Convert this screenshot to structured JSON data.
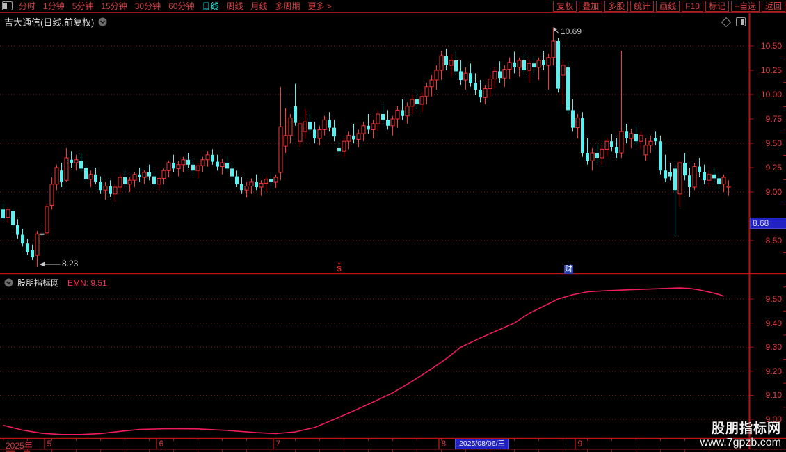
{
  "window": {
    "title": "吉大通信(日线.前复权)"
  },
  "toolbar": {
    "left_items": [
      {
        "label": "分时"
      },
      {
        "label": "1分钟"
      },
      {
        "label": "5分钟"
      },
      {
        "label": "15分钟"
      },
      {
        "label": "30分钟"
      },
      {
        "label": "60分钟"
      },
      {
        "label": "日线",
        "active": true
      },
      {
        "label": "周线"
      },
      {
        "label": "月线"
      },
      {
        "label": "多周期"
      },
      {
        "label": "更多 >"
      }
    ],
    "right_buttons": [
      "复权",
      "叠加",
      "多股",
      "统计",
      "画线",
      "F10",
      "标记",
      "+自选",
      "返回"
    ]
  },
  "indicator": {
    "source": "股朋指标网",
    "label": "EMN:",
    "value": "9.51"
  },
  "annotations": {
    "high": "10.69",
    "low": "8.23"
  },
  "price_tag": "8.68",
  "markers": {
    "dollar_arrow": "▲",
    "dollar": "$",
    "cai": "财"
  },
  "timeline": {
    "year": "2025年",
    "selected_date": "2025/08/06/三",
    "selected_index": 93,
    "months": [
      {
        "label": "5",
        "index": 9
      },
      {
        "label": "6",
        "index": 32
      },
      {
        "label": "7",
        "index": 56
      },
      {
        "label": "8",
        "index": 90
      },
      {
        "label": "9",
        "index": 118
      }
    ]
  },
  "watermark": {
    "line1": "股朋指标网",
    "line2": "www.7gpzb.com"
  },
  "icons": [
    "window-layout-icon",
    "chevron-down-circle-icon",
    "diamond-icon",
    "right-panel-toggle-icon",
    "up-arrow-icon"
  ],
  "colors": {
    "background": "#000000",
    "up_candle": "#ff3434",
    "down_candle": "#5af0f0",
    "neutral_candle": "#e0e0e0",
    "grid": "#8a1e1e",
    "frame": "#b41515",
    "axis_text": "#e04040",
    "toolbar_text": "#d23c3c",
    "active_period": "#2ee0e0",
    "title_text": "#dcdcdc",
    "indicator_line": "#ee1c5c",
    "emn_text": "#ee3350",
    "tag_blue": "#2121c4",
    "marker_blue": "#2440b8",
    "marker_red": "#e22828",
    "annotation_text": "#c8c8c8",
    "watermark": "#f2f2f2"
  },
  "chart_data": {
    "type": "candlestick",
    "title": "吉大通信(日线.前复权)",
    "main_panel": {
      "type": "candlestick",
      "ylim": [
        8.2,
        10.75
      ],
      "y_ticks": [
        {
          "label": "10.50",
          "value": 10.5
        },
        {
          "label": "10.25",
          "value": 10.25
        },
        {
          "label": "10.00",
          "value": 10.0
        },
        {
          "label": "9.75",
          "value": 9.75
        },
        {
          "label": "9.50",
          "value": 9.5
        },
        {
          "label": "9.25",
          "value": 9.25
        },
        {
          "label": "9.00",
          "value": 9.0
        },
        {
          "label": "8.50",
          "value": 8.5
        }
      ],
      "grid_levels": [
        10.5,
        10.0,
        9.5,
        9.0,
        8.5
      ],
      "high_point": {
        "index": 113,
        "price": 10.69
      },
      "low_point": {
        "index": 7,
        "price": 8.23
      },
      "last_price": 8.68,
      "white_candles": [
        8
      ],
      "candles": [
        [
          8.82,
          8.88,
          8.7,
          8.73
        ],
        [
          8.74,
          8.85,
          8.68,
          8.82
        ],
        [
          8.8,
          8.83,
          8.62,
          8.66
        ],
        [
          8.66,
          8.72,
          8.52,
          8.56
        ],
        [
          8.56,
          8.62,
          8.44,
          8.47
        ],
        [
          8.47,
          8.52,
          8.35,
          8.38
        ],
        [
          8.4,
          8.46,
          8.3,
          8.33
        ],
        [
          8.35,
          8.6,
          8.23,
          8.57
        ],
        [
          8.57,
          8.66,
          8.48,
          8.57
        ],
        [
          8.58,
          8.88,
          8.55,
          8.85
        ],
        [
          8.86,
          9.15,
          8.82,
          9.08
        ],
        [
          9.08,
          9.28,
          9.02,
          9.25
        ],
        [
          9.22,
          9.3,
          9.05,
          9.1
        ],
        [
          9.12,
          9.45,
          9.1,
          9.35
        ],
        [
          9.33,
          9.42,
          9.25,
          9.3
        ],
        [
          9.3,
          9.38,
          9.22,
          9.33
        ],
        [
          9.32,
          9.4,
          9.2,
          9.24
        ],
        [
          9.25,
          9.3,
          9.1,
          9.13
        ],
        [
          9.13,
          9.22,
          9.05,
          9.18
        ],
        [
          9.18,
          9.25,
          9.08,
          9.1
        ],
        [
          9.1,
          9.16,
          8.98,
          9.02
        ],
        [
          9.02,
          9.1,
          8.92,
          9.06
        ],
        [
          9.06,
          9.12,
          8.95,
          8.98
        ],
        [
          8.98,
          9.08,
          8.9,
          9.05
        ],
        [
          9.05,
          9.18,
          9.0,
          9.15
        ],
        [
          9.15,
          9.22,
          9.05,
          9.08
        ],
        [
          9.08,
          9.15,
          9.0,
          9.12
        ],
        [
          9.12,
          9.2,
          9.05,
          9.18
        ],
        [
          9.18,
          9.25,
          9.1,
          9.15
        ],
        [
          9.15,
          9.22,
          9.08,
          9.2
        ],
        [
          9.2,
          9.28,
          9.12,
          9.16
        ],
        [
          9.16,
          9.22,
          9.05,
          9.08
        ],
        [
          9.08,
          9.16,
          9.02,
          9.14
        ],
        [
          9.14,
          9.24,
          9.08,
          9.22
        ],
        [
          9.22,
          9.32,
          9.15,
          9.3
        ],
        [
          9.3,
          9.38,
          9.2,
          9.24
        ],
        [
          9.24,
          9.32,
          9.16,
          9.28
        ],
        [
          9.28,
          9.36,
          9.2,
          9.33
        ],
        [
          9.33,
          9.4,
          9.25,
          9.28
        ],
        [
          9.28,
          9.35,
          9.18,
          9.22
        ],
        [
          9.22,
          9.3,
          9.14,
          9.27
        ],
        [
          9.27,
          9.36,
          9.2,
          9.33
        ],
        [
          9.33,
          9.42,
          9.26,
          9.38
        ],
        [
          9.38,
          9.44,
          9.28,
          9.31
        ],
        [
          9.31,
          9.38,
          9.22,
          9.26
        ],
        [
          9.26,
          9.34,
          9.18,
          9.3
        ],
        [
          9.3,
          9.36,
          9.2,
          9.24
        ],
        [
          9.24,
          9.3,
          9.12,
          9.16
        ],
        [
          9.16,
          9.22,
          9.05,
          9.08
        ],
        [
          9.08,
          9.15,
          8.98,
          9.02
        ],
        [
          9.02,
          9.1,
          8.94,
          9.06
        ],
        [
          9.06,
          9.14,
          8.98,
          9.1
        ],
        [
          9.1,
          9.18,
          9.02,
          9.05
        ],
        [
          9.05,
          9.12,
          8.96,
          9.09
        ],
        [
          9.09,
          9.16,
          9.0,
          9.13
        ],
        [
          9.13,
          9.2,
          9.06,
          9.1
        ],
        [
          9.1,
          9.18,
          9.04,
          9.15
        ],
        [
          9.2,
          10.08,
          9.12,
          9.67
        ],
        [
          9.47,
          9.86,
          9.4,
          9.58
        ],
        [
          9.58,
          9.8,
          9.5,
          9.76
        ],
        [
          9.88,
          10.11,
          9.68,
          9.71
        ],
        [
          9.52,
          9.74,
          9.46,
          9.7
        ],
        [
          9.62,
          9.85,
          9.55,
          9.72
        ],
        [
          9.72,
          9.8,
          9.6,
          9.64
        ],
        [
          9.64,
          9.72,
          9.5,
          9.55
        ],
        [
          9.55,
          9.68,
          9.48,
          9.64
        ],
        [
          9.64,
          9.78,
          9.58,
          9.74
        ],
        [
          9.74,
          9.82,
          9.62,
          9.66
        ],
        [
          9.66,
          9.74,
          9.52,
          9.57
        ],
        [
          9.45,
          9.52,
          9.38,
          9.42
        ],
        [
          9.42,
          9.55,
          9.36,
          9.52
        ],
        [
          9.52,
          9.62,
          9.44,
          9.58
        ],
        [
          9.58,
          9.7,
          9.5,
          9.54
        ],
        [
          9.54,
          9.64,
          9.46,
          9.6
        ],
        [
          9.6,
          9.72,
          9.52,
          9.68
        ],
        [
          9.68,
          9.8,
          9.6,
          9.64
        ],
        [
          9.64,
          9.74,
          9.55,
          9.7
        ],
        [
          9.7,
          9.84,
          9.62,
          9.8
        ],
        [
          9.8,
          9.9,
          9.7,
          9.74
        ],
        [
          9.74,
          9.84,
          9.64,
          9.68
        ],
        [
          9.68,
          9.78,
          9.58,
          9.75
        ],
        [
          9.75,
          9.88,
          9.66,
          9.84
        ],
        [
          9.84,
          9.95,
          9.74,
          9.78
        ],
        [
          9.78,
          9.92,
          9.7,
          9.88
        ],
        [
          9.88,
          10.0,
          9.8,
          9.95
        ],
        [
          9.95,
          10.05,
          9.85,
          9.9
        ],
        [
          9.9,
          10.02,
          9.82,
          9.98
        ],
        [
          9.98,
          10.12,
          9.9,
          10.08
        ],
        [
          10.08,
          10.2,
          9.98,
          10.15
        ],
        [
          10.15,
          10.3,
          10.05,
          10.25
        ],
        [
          10.25,
          10.45,
          10.15,
          10.4
        ],
        [
          10.4,
          10.47,
          10.25,
          10.3
        ],
        [
          10.3,
          10.42,
          10.18,
          10.35
        ],
        [
          10.35,
          10.44,
          10.2,
          10.24
        ],
        [
          10.24,
          10.35,
          10.1,
          10.15
        ],
        [
          10.15,
          10.28,
          10.05,
          10.22
        ],
        [
          10.22,
          10.32,
          10.08,
          10.12
        ],
        [
          10.12,
          10.22,
          10.0,
          10.05
        ],
        [
          10.05,
          10.15,
          9.92,
          9.97
        ],
        [
          9.97,
          10.1,
          9.9,
          10.06
        ],
        [
          10.06,
          10.2,
          9.98,
          10.16
        ],
        [
          10.16,
          10.28,
          10.06,
          10.24
        ],
        [
          10.24,
          10.34,
          10.12,
          10.17
        ],
        [
          10.17,
          10.3,
          10.08,
          10.26
        ],
        [
          10.26,
          10.38,
          10.16,
          10.33
        ],
        [
          10.33,
          10.44,
          10.22,
          10.28
        ],
        [
          10.28,
          10.38,
          10.18,
          10.35
        ],
        [
          10.35,
          10.42,
          10.2,
          10.25
        ],
        [
          10.25,
          10.36,
          10.12,
          10.32
        ],
        [
          10.32,
          10.4,
          10.22,
          10.28
        ],
        [
          10.28,
          10.38,
          10.15,
          10.35
        ],
        [
          10.35,
          10.45,
          10.25,
          10.3
        ],
        [
          10.3,
          10.42,
          10.05,
          10.38
        ],
        [
          10.38,
          10.69,
          10.3,
          10.55
        ],
        [
          10.55,
          10.58,
          10.02,
          10.06
        ],
        [
          10.2,
          10.36,
          9.9,
          10.3
        ],
        [
          10.28,
          10.33,
          9.8,
          9.84
        ],
        [
          9.84,
          9.95,
          9.62,
          9.66
        ],
        [
          9.66,
          9.8,
          9.55,
          9.76
        ],
        [
          9.76,
          9.82,
          9.36,
          9.4
        ],
        [
          9.4,
          9.55,
          9.28,
          9.32
        ],
        [
          9.32,
          9.45,
          9.22,
          9.4
        ],
        [
          9.4,
          9.5,
          9.3,
          9.35
        ],
        [
          9.35,
          9.48,
          9.28,
          9.44
        ],
        [
          9.44,
          9.56,
          9.36,
          9.52
        ],
        [
          9.52,
          9.6,
          9.42,
          9.46
        ],
        [
          9.46,
          9.55,
          9.35,
          9.4
        ],
        [
          9.4,
          10.45,
          9.35,
          9.62
        ],
        [
          9.62,
          9.7,
          9.5,
          9.55
        ],
        [
          9.55,
          9.65,
          9.45,
          9.6
        ],
        [
          9.6,
          9.68,
          9.48,
          9.52
        ],
        [
          9.52,
          9.62,
          9.44,
          9.58
        ],
        [
          9.38,
          9.55,
          9.32,
          9.48
        ],
        [
          9.48,
          9.58,
          9.4,
          9.52
        ],
        [
          9.55,
          9.62,
          9.48,
          9.52
        ],
        [
          9.52,
          9.58,
          9.18,
          9.22
        ],
        [
          9.22,
          9.38,
          9.1,
          9.14
        ],
        [
          9.2,
          9.3,
          9.12,
          9.16
        ],
        [
          9.24,
          9.28,
          8.55,
          9.02
        ],
        [
          8.98,
          9.32,
          8.85,
          9.3
        ],
        [
          9.3,
          9.4,
          9.12,
          9.17
        ],
        [
          9.17,
          9.25,
          8.95,
          9.05
        ],
        [
          9.05,
          9.3,
          9.02,
          9.26
        ],
        [
          9.26,
          9.35,
          9.15,
          9.2
        ],
        [
          9.2,
          9.28,
          9.08,
          9.12
        ],
        [
          9.12,
          9.22,
          9.05,
          9.18
        ],
        [
          9.18,
          9.24,
          9.1,
          9.14
        ],
        [
          9.14,
          9.2,
          9.02,
          9.08
        ],
        [
          9.08,
          9.18,
          9.0,
          9.15
        ],
        [
          9.05,
          9.12,
          8.96,
          9.06
        ]
      ]
    },
    "indicator_panel": {
      "type": "line",
      "name": "EMN",
      "last_value": 9.51,
      "ylim": [
        8.9,
        9.6
      ],
      "y_ticks": [
        {
          "label": "9.50",
          "value": 9.5
        },
        {
          "label": "9.40",
          "value": 9.4
        },
        {
          "label": "9.30",
          "value": 9.3
        },
        {
          "label": "9.20",
          "value": 9.2
        },
        {
          "label": "9.10",
          "value": 9.1
        },
        {
          "label": "9.00",
          "value": 9.0
        }
      ],
      "points": [
        [
          0,
          8.975
        ],
        [
          4,
          8.955
        ],
        [
          8,
          8.942
        ],
        [
          12,
          8.937
        ],
        [
          16,
          8.937
        ],
        [
          20,
          8.941
        ],
        [
          24,
          8.95
        ],
        [
          28,
          8.958
        ],
        [
          34,
          8.961
        ],
        [
          40,
          8.96
        ],
        [
          46,
          8.954
        ],
        [
          52,
          8.945
        ],
        [
          56,
          8.941
        ],
        [
          60,
          8.948
        ],
        [
          64,
          8.966
        ],
        [
          68,
          9.0
        ],
        [
          72,
          9.035
        ],
        [
          76,
          9.072
        ],
        [
          80,
          9.11
        ],
        [
          84,
          9.158
        ],
        [
          88,
          9.21
        ],
        [
          91,
          9.252
        ],
        [
          94,
          9.3
        ],
        [
          98,
          9.338
        ],
        [
          101,
          9.365
        ],
        [
          105,
          9.4
        ],
        [
          108,
          9.44
        ],
        [
          111,
          9.47
        ],
        [
          114,
          9.5
        ],
        [
          117,
          9.518
        ],
        [
          120,
          9.53
        ],
        [
          124,
          9.535
        ],
        [
          128,
          9.538
        ],
        [
          132,
          9.541
        ],
        [
          136,
          9.544
        ],
        [
          139,
          9.546
        ],
        [
          141,
          9.544
        ],
        [
          143,
          9.538
        ],
        [
          145,
          9.529
        ],
        [
          147,
          9.519
        ],
        [
          148,
          9.512
        ]
      ]
    }
  }
}
